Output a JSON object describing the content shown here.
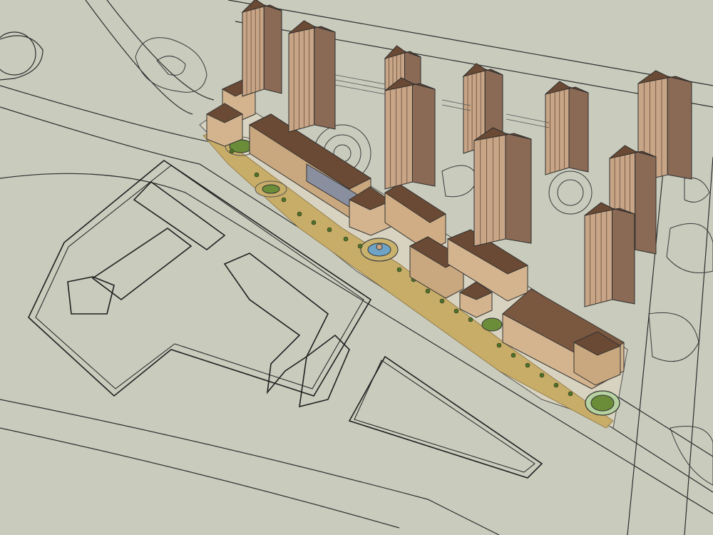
{
  "viewport": {
    "type": "3d-model-viewport",
    "background_color": "#c9cbbd",
    "line_color": "#2d2d2d"
  },
  "scene": {
    "style": "urban-masterplan",
    "palette": {
      "tower_wall": "#c7a586",
      "tower_shadow": "#8a6a55",
      "roof_brown": "#6a4a34",
      "shop_wall": "#d3b48f",
      "plaza_paving": "#c8ad69",
      "lawn": "#6b8d3a",
      "water": "#6fa3c6"
    },
    "towers": [
      {
        "id": "tower-nw-1"
      },
      {
        "id": "tower-nw-2"
      },
      {
        "id": "tower-center-1"
      },
      {
        "id": "tower-center-2"
      },
      {
        "id": "tower-mid-1"
      },
      {
        "id": "tower-mid-2"
      },
      {
        "id": "tower-east-1"
      },
      {
        "id": "tower-east-2"
      },
      {
        "id": "tower-east-3"
      },
      {
        "id": "tower-east-4"
      }
    ],
    "commercial_blocks": 8,
    "plazas": [
      "fountain-plaza",
      "north-roundabout",
      "south-roundabout",
      "corner-garden"
    ]
  }
}
